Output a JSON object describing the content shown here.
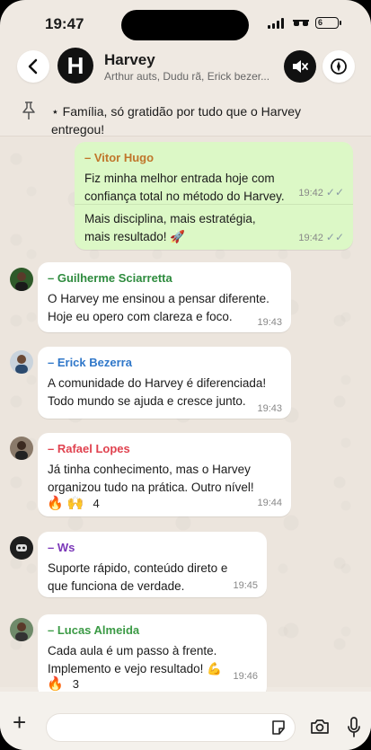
{
  "status_bar": {
    "time": "19:47",
    "battery": "6"
  },
  "header": {
    "avatar_letter": "H",
    "title": "Harvey",
    "subtitle": "Arthur auts, Dudu rã, Erick bezer..."
  },
  "pinned": {
    "text": "⋆ Família, só gratidão por tudo que o Harvey entregou!"
  },
  "messages": [
    {
      "sender": "– Vitor Hugo",
      "text": "Fiz minha melhor entrada hoje com confiança total no método do Harvey.",
      "time": "19:42",
      "text2": "Mais disciplina,  mais estratégia, mais resultado! 🚀",
      "time2": "19:42",
      "ticks": "✓✓"
    },
    {
      "sender": "– Guilherme Sciarretta",
      "text": "O Harvey me ensinou a pensar diferente. Hoje eu opero com clareza e foco.",
      "time": "19:43"
    },
    {
      "sender": "– Erick Bezerra",
      "text": "A comunidade do Harvey é diferenciada! Todo mundo se ajuda e cresce junto.",
      "time": "19:43"
    },
    {
      "sender": "– Rafael Lopes",
      "text": "Já tinha conhecimento, mas o Harvey organizou tudo na prática. Outro nível!",
      "time": "19:44",
      "reactions": "🔥 🙌",
      "reaction_count": "4"
    },
    {
      "sender": "– Ws",
      "text": "Suporte rápido, conteúdo direto e que funciona de verdade.",
      "time": "19:45"
    },
    {
      "sender": "– Lucas Almeida",
      "text": "Cada aula é um passo à frente. Implemento e vejo resultado! 💪",
      "time": "19:46",
      "reactions": "🔥",
      "reaction_count": "3"
    }
  ],
  "colors": {
    "vitor": "#c0762b",
    "guilherme": "#2e8b3e",
    "erick": "#2f77c9",
    "rafael": "#e0424f",
    "ws": "#7a37b8",
    "lucas": "#3b9a45",
    "outgoing_bubble": "#dcf8c6",
    "background": "#ece5dd"
  },
  "input": {
    "placeholder": ""
  }
}
